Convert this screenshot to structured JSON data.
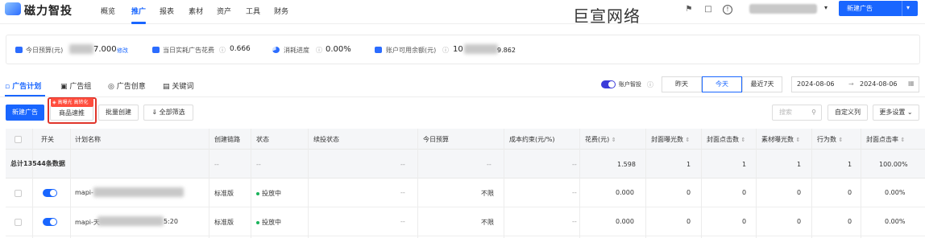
{
  "app": {
    "logo_text": "磁力智投",
    "watermark": "巨宣网络"
  },
  "nav": {
    "items": [
      "概览",
      "推广",
      "报表",
      "素材",
      "资产",
      "工具",
      "财务"
    ],
    "active": "推广"
  },
  "header": {
    "new_ad_label": "新建广告"
  },
  "stats": {
    "budget_label": "今日预算(元)",
    "budget_suffix": "7.000",
    "budget_edit": "修改",
    "spend_label": "当日实耗广告花费",
    "spend_value": "0.666",
    "progress_label": "消耗进度",
    "progress_value": "0.00%",
    "balance_label": "账户可用余额(元)",
    "balance_prefix": "10",
    "balance_suffix": "9.862"
  },
  "tabs": [
    "广告计划",
    "广告组",
    "广告创意",
    "关键词"
  ],
  "account_smart": "账户智投",
  "date_segments": [
    "昨天",
    "今天",
    "最近7天"
  ],
  "date_range": {
    "start": "2024-08-06",
    "arrow": "→",
    "end": "2024-08-06"
  },
  "toolbar": {
    "new_ad": "新建广告",
    "hot_tag": "高曝光 高转化",
    "product_promo": "商品速推",
    "batch_create": "批量创建",
    "all_filter": "全部筛选",
    "search_placeholder": "搜索",
    "custom_columns": "自定义列",
    "more_settings": "更多设置"
  },
  "table": {
    "headers": [
      "开关",
      "计划名称",
      "创建链路",
      "状态",
      "续投状态",
      "今日预算",
      "成本约束(元/%)",
      "花费(元)",
      "封面曝光数",
      "封面点击数",
      "素材曝光数",
      "行为数",
      "封面点击率"
    ],
    "summary": {
      "label": "总计13544条数据",
      "chain": "--",
      "status": "--",
      "renew": "--",
      "budget": "--",
      "cost": "--",
      "spend": "1.598",
      "cover_exp": "1",
      "cover_click": "1",
      "mat_exp": "1",
      "actions": "1",
      "ctr": "100.00%"
    },
    "rows": [
      {
        "name_prefix": "mapi-",
        "name_suffix": "",
        "chain": "标准版",
        "status": "投放中",
        "renew": "--",
        "budget": "不限",
        "cost": "--",
        "spend": "0.000",
        "cover_exp": "0",
        "cover_click": "0",
        "mat_exp": "0",
        "actions": "0",
        "ctr": "0.00%"
      },
      {
        "name_prefix": "mapi-天",
        "name_suffix": "5:20",
        "chain": "标准版",
        "status": "投放中",
        "renew": "--",
        "budget": "不限",
        "cost": "--",
        "spend": "0.000",
        "cover_exp": "0",
        "cover_click": "0",
        "mat_exp": "0",
        "actions": "0",
        "ctr": "0.00%"
      }
    ]
  }
}
